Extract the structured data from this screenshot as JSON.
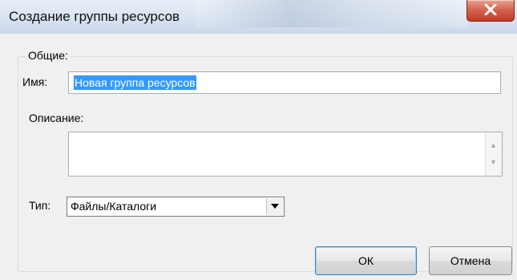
{
  "window": {
    "title": "Создание группы ресурсов",
    "close_icon": "close-x-icon"
  },
  "group": {
    "legend": "Общие:",
    "name_label": "Имя:",
    "name_value": "Новая группа ресурсов",
    "description_label": "Описание:",
    "description_value": "",
    "type_label": "Тип:",
    "type_value": "Файлы/Каталоги"
  },
  "buttons": {
    "ok_label": "ОК",
    "cancel_label": "Отмена"
  },
  "colors": {
    "selection": "#3399ff",
    "close_button": "#c94a33"
  }
}
